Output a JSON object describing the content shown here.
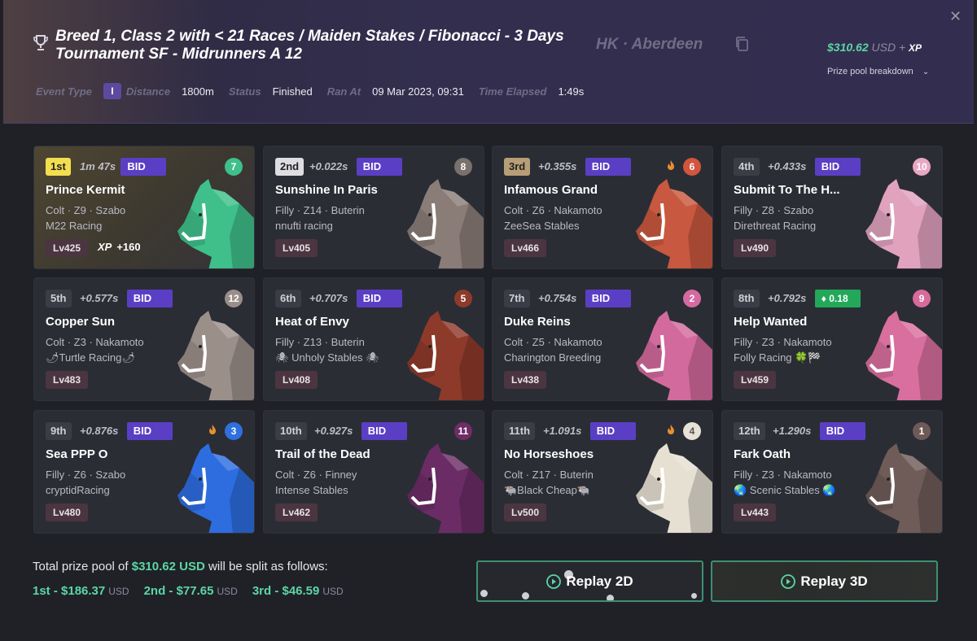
{
  "header": {
    "title": "Breed 1, Class 2 with < 21 Races / Maiden Stakes / Fibonacci - 3 Days Tournament SF - Midrunners A 12",
    "location": "HK · Aberdeen",
    "prize_amount": "$310.62",
    "prize_currency": "USD",
    "prize_plus": "+",
    "prize_xp": "XP",
    "prize_breakdown_label": "Prize pool breakdown",
    "meta": {
      "event_type_label": "Event Type",
      "event_type_value": "I",
      "distance_label": "Distance",
      "distance_value": "1800m",
      "status_label": "Status",
      "status_value": "Finished",
      "ran_at_label": "Ran At",
      "ran_at_value": "09 Mar 2023, 09:31",
      "time_elapsed_label": "Time Elapsed",
      "time_elapsed_value": "1:49s"
    }
  },
  "results": [
    {
      "pos": "1st",
      "time": "1m 47s",
      "bid": "BID",
      "gate": "7",
      "gate_color": "#3fbf8a",
      "name": "Prince Kermit",
      "info": "Colt · Z9 · Szabo",
      "stable": "M22 Racing",
      "level": "Lv425",
      "xp_label": "XP",
      "xp_value": "+160",
      "coat": "#3fbf8a",
      "fire": false
    },
    {
      "pos": "2nd",
      "time": "+0.022s",
      "bid": "BID",
      "gate": "8",
      "gate_color": "#7a706c",
      "name": "Sunshine In Paris",
      "info": "Filly · Z14 · Buterin",
      "stable": "nnufti racing",
      "level": "Lv405",
      "coat": "#8a7d78",
      "fire": false
    },
    {
      "pos": "3rd",
      "time": "+0.355s",
      "bid": "BID",
      "gate": "6",
      "gate_color": "#d2553e",
      "name": "Infamous Grand",
      "info": "Colt · Z6 · Nakamoto",
      "stable": "ZeeSea Stables",
      "level": "Lv466",
      "coat": "#c8583f",
      "fire": true
    },
    {
      "pos": "4th",
      "time": "+0.433s",
      "bid": "BID",
      "gate": "10",
      "gate_color": "#e8a7c3",
      "name": "Submit To The H...",
      "info": "Filly · Z8 · Szabo",
      "stable": "Direthreat Racing",
      "level": "Lv490",
      "coat": "#e0a2bd",
      "fire": false
    },
    {
      "pos": "5th",
      "time": "+0.577s",
      "bid": "BID",
      "gate": "12",
      "gate_color": "#9a8e8a",
      "name": "Copper Sun",
      "info": "Colt · Z3 · Nakamoto",
      "stable": "🌶Turtle Racing🌶",
      "level": "Lv483",
      "coat": "#9b8f8a",
      "fire": false
    },
    {
      "pos": "6th",
      "time": "+0.707s",
      "bid": "BID",
      "gate": "5",
      "gate_color": "#8e3a2a",
      "name": "Heat of Envy",
      "info": "Filly · Z13 · Buterin",
      "stable": "🕷 Unholy Stables 🕷",
      "level": "Lv408",
      "coat": "#8e3a2a",
      "fire": false
    },
    {
      "pos": "7th",
      "time": "+0.754s",
      "bid": "BID",
      "gate": "2",
      "gate_color": "#d56aa0",
      "name": "Duke Reins",
      "info": "Colt · Z5 · Nakamoto",
      "stable": "Charington Breeding",
      "level": "Lv438",
      "coat": "#d26a9d",
      "fire": false
    },
    {
      "pos": "8th",
      "time": "+0.792s",
      "eth": "0.18",
      "gate": "9",
      "gate_color": "#d86a9c",
      "name": "Help Wanted",
      "info": "Filly · Z3 · Nakamoto",
      "stable": "Folly Racing 🍀🏁",
      "level": "Lv459",
      "coat": "#d96f9f",
      "fire": false
    },
    {
      "pos": "9th",
      "time": "+0.876s",
      "bid": "BID",
      "gate": "3",
      "gate_color": "#2f6fe0",
      "name": "Sea PPP O",
      "info": "Filly · Z6 · Szabo",
      "stable": "cryptidRacing",
      "level": "Lv480",
      "coat": "#2e6de0",
      "fire": true
    },
    {
      "pos": "10th",
      "time": "+0.927s",
      "bid": "BID",
      "gate": "11",
      "gate_color": "#6e2d66",
      "name": "Trail of the Dead",
      "info": "Colt · Z6 · Finney",
      "stable": "Intense Stables",
      "level": "Lv462",
      "coat": "#6b2c66",
      "fire": false
    },
    {
      "pos": "11th",
      "time": "+1.091s",
      "bid": "BID",
      "gate": "4",
      "gate_color": "#e8e2d6",
      "name": "No Horseshoes",
      "info": "Colt · Z17 · Buterin",
      "stable": "🐃Black Cheap🐃",
      "level": "Lv500",
      "coat": "#e6e0d2",
      "fire": true
    },
    {
      "pos": "12th",
      "time": "+1.290s",
      "bid": "BID",
      "gate": "1",
      "gate_color": "#6d5a56",
      "name": "Fark Oath",
      "info": "Filly · Z3 · Nakamoto",
      "stable": "🌏 Scenic Stables 🌏",
      "level": "Lv443",
      "coat": "#6f5c58",
      "fire": false
    }
  ],
  "footer": {
    "split_prefix": "Total prize pool of",
    "split_amount": "$310.62 USD",
    "split_suffix": "will be split as follows:",
    "payouts": [
      {
        "label": "1st - $186.37",
        "currency": "USD"
      },
      {
        "label": "2nd - $77.65",
        "currency": "USD"
      },
      {
        "label": "3rd - $46.59",
        "currency": "USD"
      }
    ],
    "replay_2d": "Replay 2D",
    "replay_3d": "Replay 3D"
  },
  "colors": {
    "accent_green": "#5cd6a4",
    "bid_purple": "#5a3fc4",
    "eth_green": "#23a85a"
  }
}
